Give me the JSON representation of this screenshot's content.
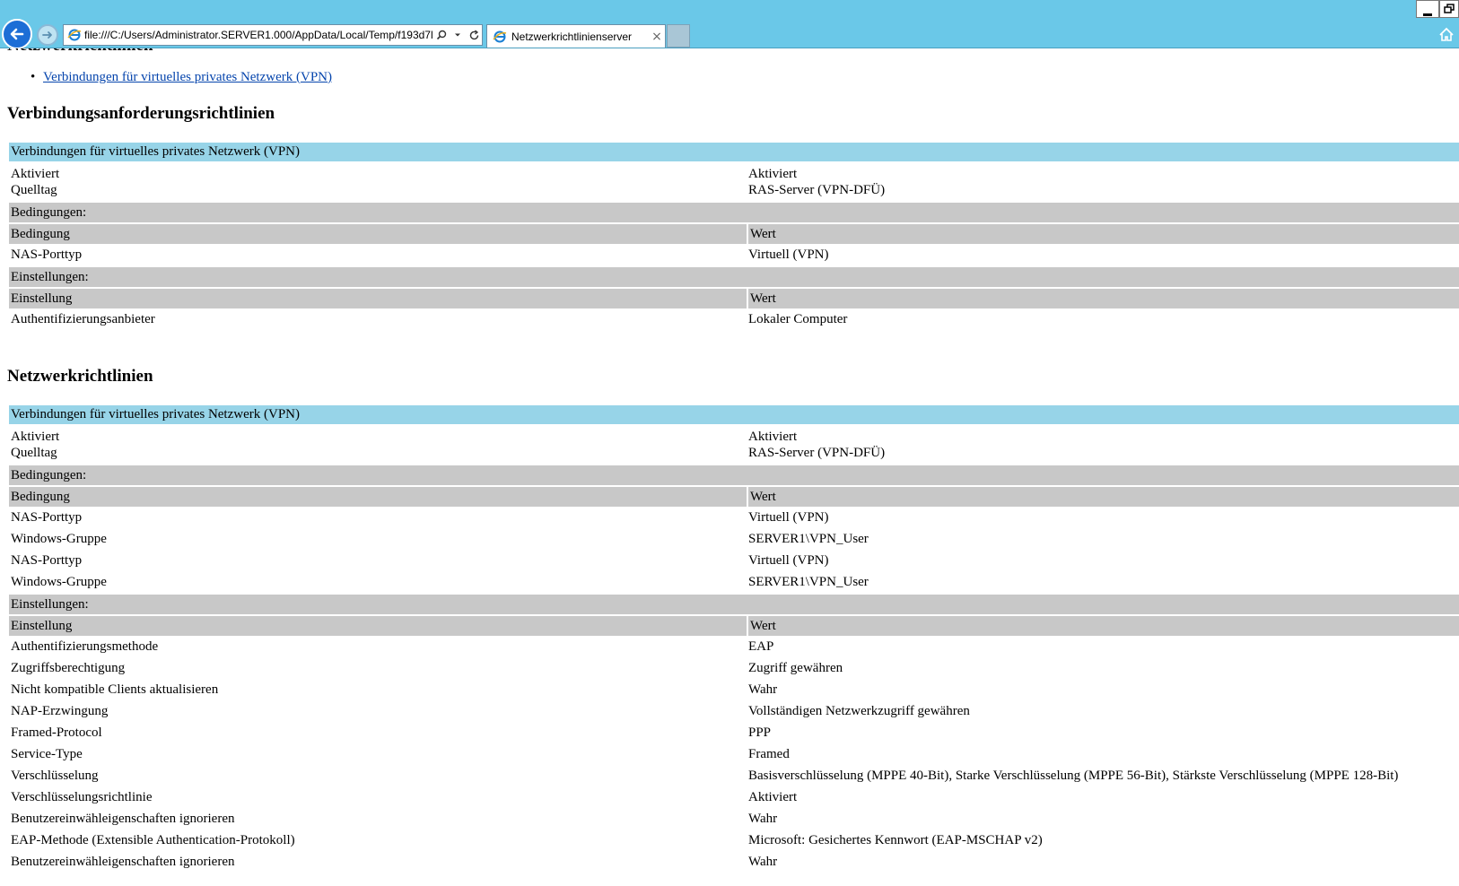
{
  "browser": {
    "address_url": "file:///C:/Users/Administrator.SERVER1.000/AppData/Local/Temp/f193d7l",
    "tab_title": "Netzwerkrichtlinienserver",
    "tab_close": "×"
  },
  "page": {
    "cut_heading": "Netzwerkrichtlinien",
    "nav_link": "Verbindungen für virtuelles privates Netzwerk (VPN)",
    "section1": {
      "title": "Verbindungsanforderungsrichtlinien",
      "policy_name": "Verbindungen für virtuelles privates Netzwerk (VPN)",
      "meta": {
        "label1": "Aktiviert",
        "label2": "Quelltag",
        "value1": "Aktiviert",
        "value2": "RAS-Server (VPN-DFÜ)"
      },
      "conditions_label": "Bedingungen:",
      "conditions_header": {
        "left": "Bedingung",
        "right": "Wert"
      },
      "conditions": [
        {
          "name": "NAS-Porttyp",
          "value": "Virtuell (VPN)"
        }
      ],
      "settings_label": "Einstellungen:",
      "settings_header": {
        "left": "Einstellung",
        "right": "Wert"
      },
      "settings": [
        {
          "name": "Authentifizierungsanbieter",
          "value": "Lokaler Computer"
        }
      ]
    },
    "section2": {
      "title": "Netzwerkrichtlinien",
      "policy_name": "Verbindungen für virtuelles privates Netzwerk (VPN)",
      "meta": {
        "label1": "Aktiviert",
        "label2": "Quelltag",
        "value1": "Aktiviert",
        "value2": "RAS-Server (VPN-DFÜ)"
      },
      "conditions_label": "Bedingungen:",
      "conditions_header": {
        "left": "Bedingung",
        "right": "Wert"
      },
      "conditions": [
        {
          "name": "NAS-Porttyp",
          "value": "Virtuell (VPN)"
        },
        {
          "name": "Windows-Gruppe",
          "value": "SERVER1\\VPN_User"
        },
        {
          "name": "NAS-Porttyp",
          "value": "Virtuell (VPN)"
        },
        {
          "name": "Windows-Gruppe",
          "value": "SERVER1\\VPN_User"
        }
      ],
      "settings_label": "Einstellungen:",
      "settings_header": {
        "left": "Einstellung",
        "right": "Wert"
      },
      "settings": [
        {
          "name": "Authentifizierungsmethode",
          "value": "EAP"
        },
        {
          "name": "Zugriffsberechtigung",
          "value": "Zugriff gewähren"
        },
        {
          "name": "Nicht kompatible Clients aktualisieren",
          "value": "Wahr"
        },
        {
          "name": "NAP-Erzwingung",
          "value": "Vollständigen Netzwerkzugriff gewähren"
        },
        {
          "name": "Framed-Protocol",
          "value": "PPP"
        },
        {
          "name": "Service-Type",
          "value": "Framed"
        },
        {
          "name": "Verschlüsselung",
          "value": "Basisverschlüsselung (MPPE 40-Bit), Starke Verschlüsselung (MPPE 56-Bit), Stärkste Verschlüsselung (MPPE 128-Bit)"
        },
        {
          "name": "Verschlüsselungsrichtlinie",
          "value": "Aktiviert"
        },
        {
          "name": "Benutzereinwähleigenschaften ignorieren",
          "value": "Wahr"
        },
        {
          "name": "EAP-Methode (Extensible Authentication-Protokoll)",
          "value": "Microsoft: Gesichertes Kennwort (EAP-MSCHAP v2)"
        },
        {
          "name": "Benutzereinwähleigenschaften ignorieren",
          "value": "Wahr"
        }
      ]
    }
  },
  "colors": {
    "chrome": "#6ac8e8",
    "policy_header": "#97d4e8",
    "section_header": "#c8c8c8",
    "link": "#0645ad"
  }
}
